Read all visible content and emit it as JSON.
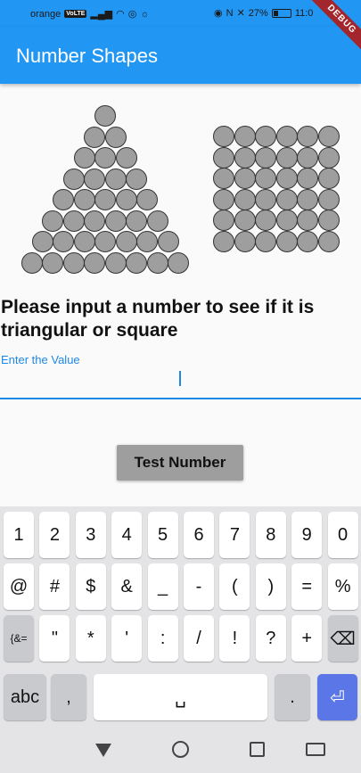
{
  "status_bar": {
    "carrier": "orange",
    "carrier_badge": "VoLTE",
    "battery": "27%",
    "time": "11:0"
  },
  "app_bar": {
    "title": "Number Shapes",
    "debug_banner": "DEBUG"
  },
  "shapes": {
    "triangle_rows": 8,
    "square_size": 6,
    "ball_color": "#9e9e9e"
  },
  "prompt": "Please input a number to see if it is triangular or square",
  "input": {
    "label": "Enter the Value",
    "value": ""
  },
  "test_button": "Test Number",
  "keyboard": {
    "row1": [
      "1",
      "2",
      "3",
      "4",
      "5",
      "6",
      "7",
      "8",
      "9",
      "0"
    ],
    "row2": [
      "@",
      "#",
      "$",
      "&",
      "_",
      "-",
      "(",
      ")",
      "=",
      "%"
    ],
    "row3": [
      "{&=",
      "\"",
      "*",
      "'",
      ":",
      "/",
      "!",
      "?",
      "+",
      "⌫"
    ],
    "row4": [
      "abc",
      ",",
      "␣",
      ".",
      "⏎"
    ]
  },
  "colors": {
    "primary": "#2196f3",
    "accent": "#1e88e5",
    "enter": "#5b76e6"
  }
}
